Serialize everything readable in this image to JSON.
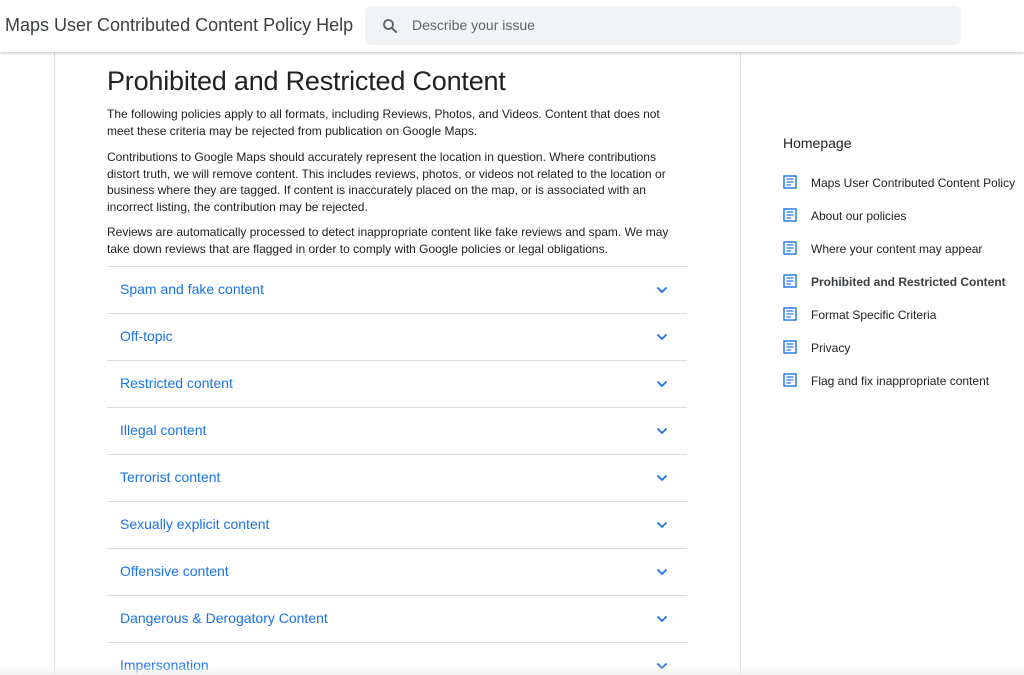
{
  "header": {
    "title": "Maps User Contributed Content Policy Help",
    "search_placeholder": "Describe your issue"
  },
  "main": {
    "title": "Prohibited and Restricted Content",
    "paragraphs": [
      "The following policies apply to all formats, including Reviews, Photos, and Videos. Content that does not meet these criteria may be rejected from publication on Google Maps.",
      "Contributions to Google Maps should accurately represent the location in question. Where contributions distort truth, we will remove content. This includes reviews, photos, or videos not related to the location or business where they are tagged. If content is inaccurately placed on the map, or is associated with an incorrect listing, the contribution may be rejected.",
      "Reviews are automatically processed to detect inappropriate content like fake reviews and spam. We may take down reviews that are flagged in order to comply with Google policies or legal obligations."
    ],
    "accordion": [
      {
        "label": "Spam and fake content"
      },
      {
        "label": "Off-topic"
      },
      {
        "label": "Restricted content"
      },
      {
        "label": "Illegal content"
      },
      {
        "label": "Terrorist content"
      },
      {
        "label": "Sexually explicit content"
      },
      {
        "label": "Offensive content"
      },
      {
        "label": "Dangerous & Derogatory Content"
      },
      {
        "label": "Impersonation"
      }
    ]
  },
  "sidebar": {
    "heading": "Homepage",
    "items": [
      {
        "label": "Maps User Contributed Content Policy",
        "active": false
      },
      {
        "label": "About our policies",
        "active": false
      },
      {
        "label": "Where your content may appear",
        "active": false
      },
      {
        "label": "Prohibited and Restricted Content",
        "active": true
      },
      {
        "label": "Format Specific Criteria",
        "active": false
      },
      {
        "label": "Privacy",
        "active": false
      },
      {
        "label": "Flag and fix inappropriate content",
        "active": false
      }
    ]
  },
  "colors": {
    "link": "#1a73e8",
    "icon": "#1a73e8",
    "search_bg": "#f1f3f4"
  },
  "icons": {
    "search": "search-icon",
    "chevron": "chevron-down-icon",
    "article": "article-icon"
  }
}
